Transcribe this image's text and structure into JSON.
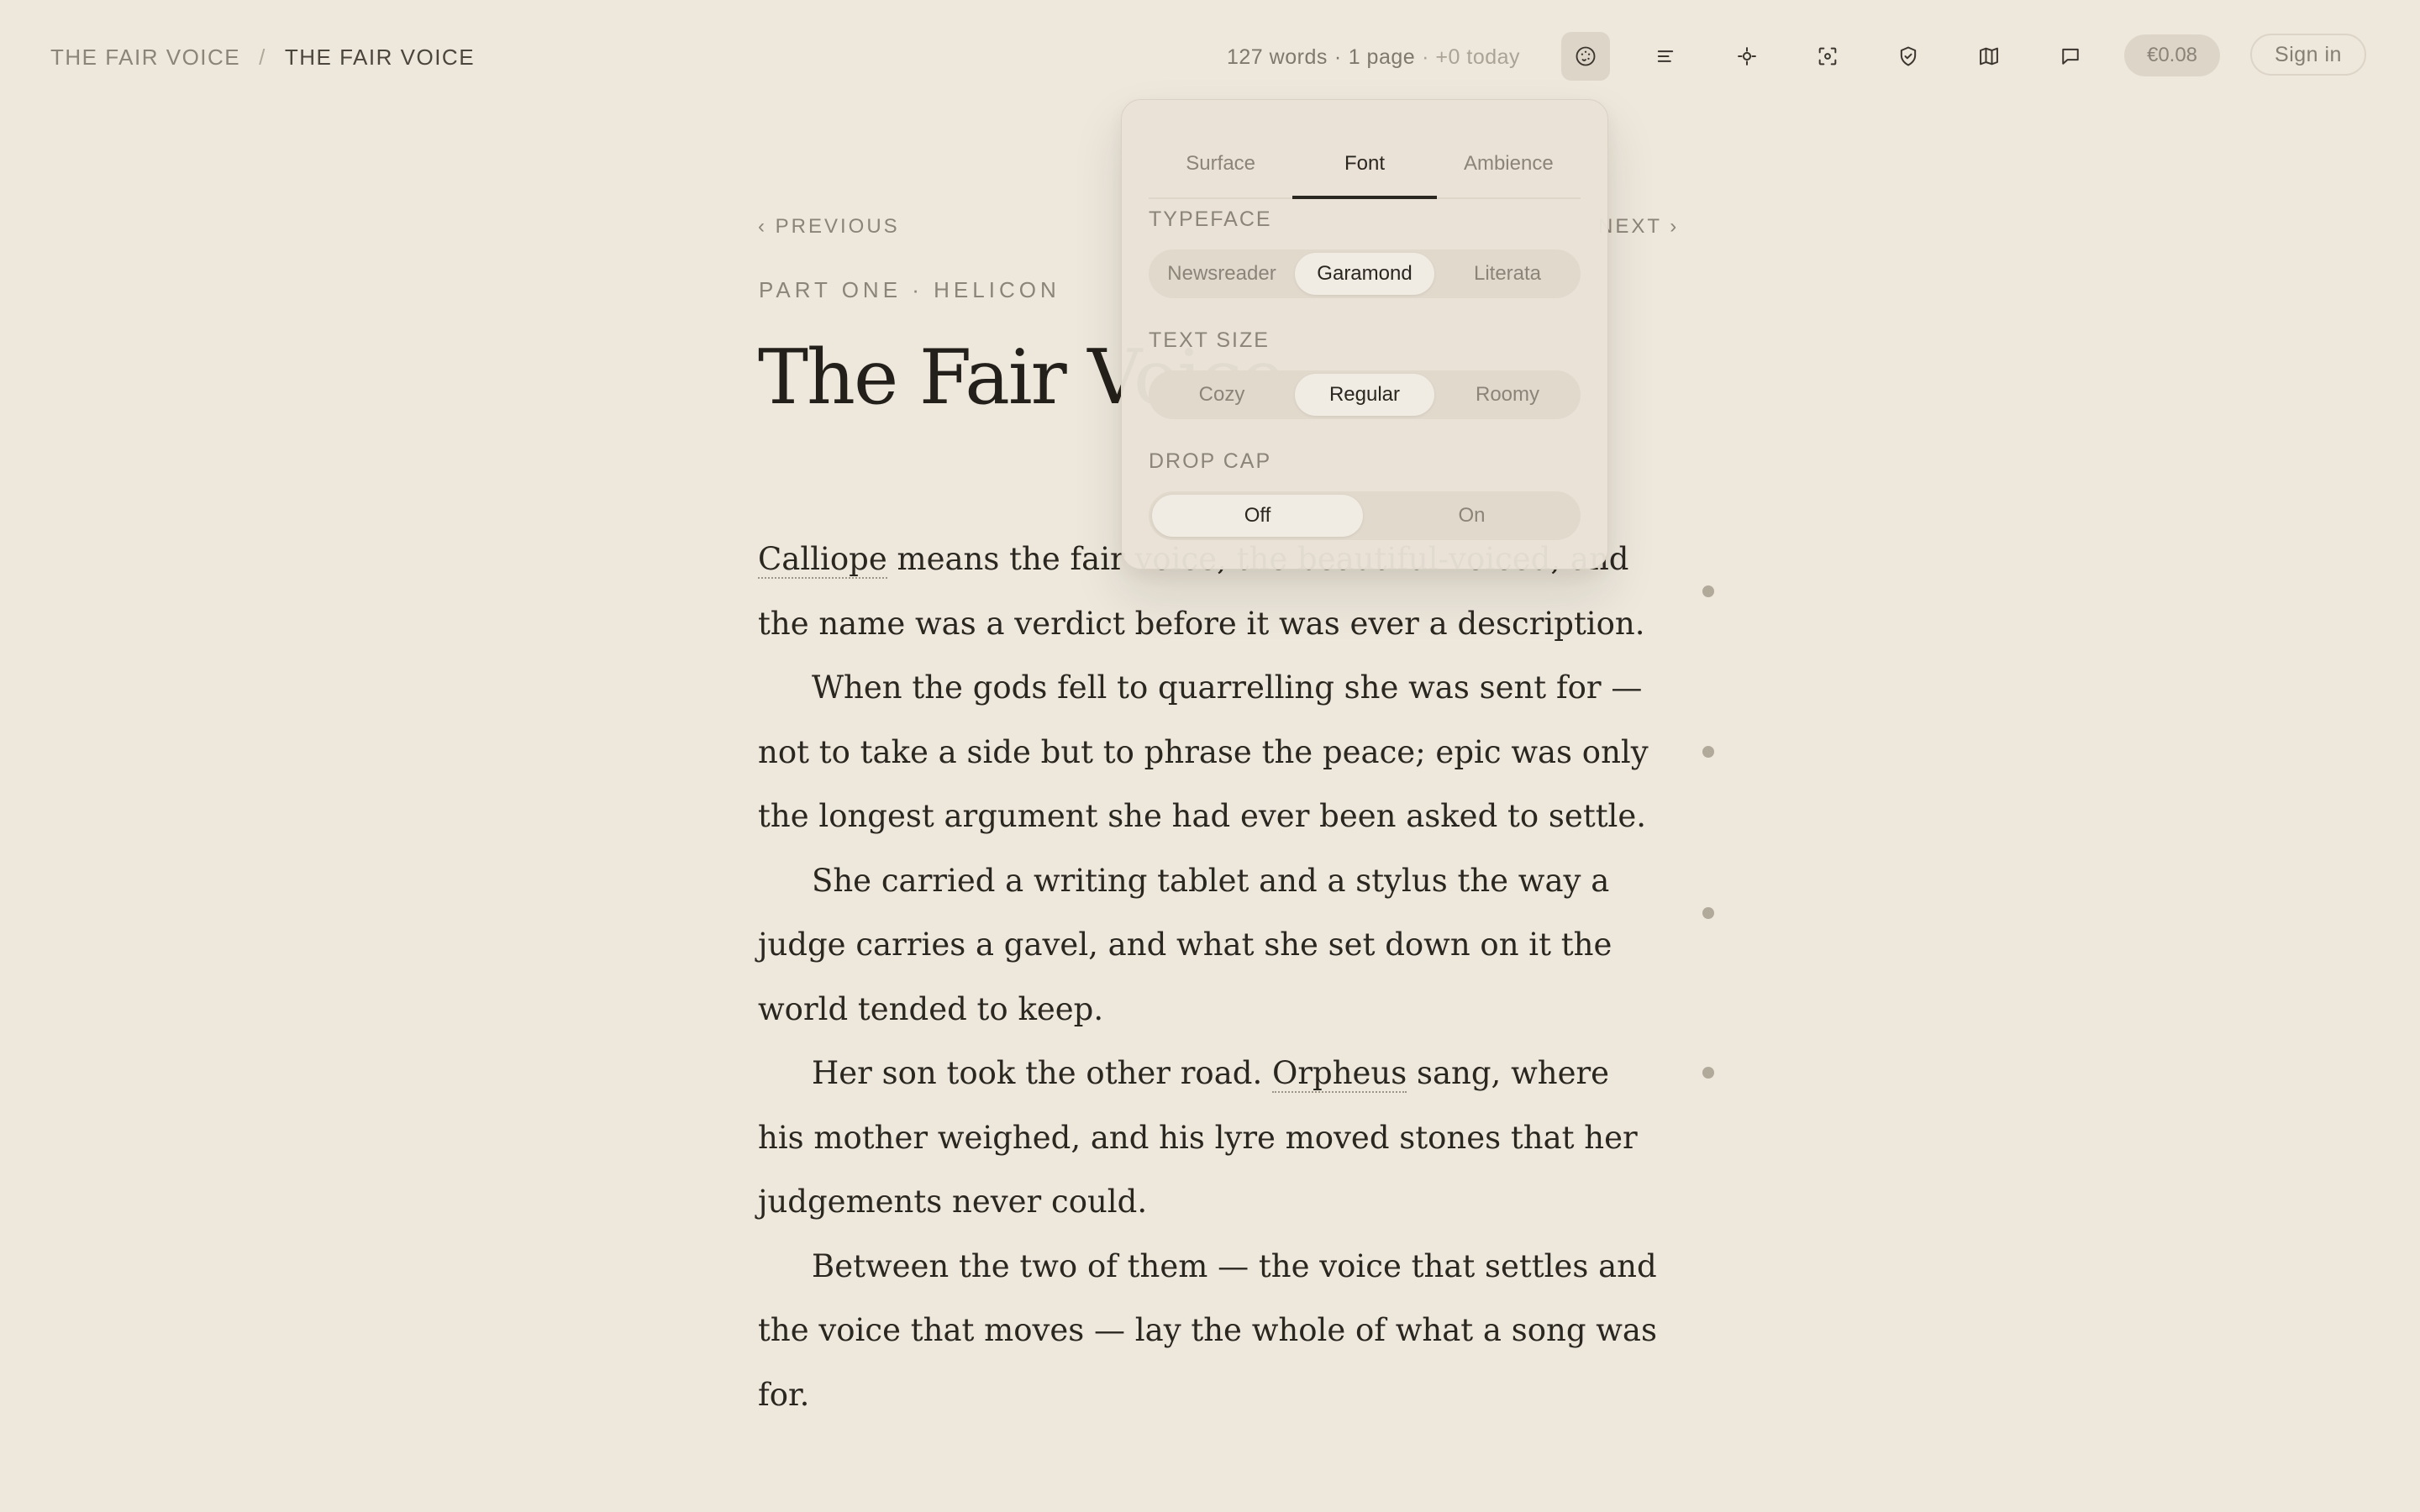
{
  "breadcrumb": {
    "root": "THE FAIR VOICE",
    "separator": "/",
    "current": "THE FAIR VOICE"
  },
  "stats": {
    "words": "127 words",
    "dot": "·",
    "pages": "1 page",
    "today": "· +0 today"
  },
  "toolbar": {
    "icons": [
      "palette-icon",
      "align-icon",
      "focus-icon",
      "capture-icon",
      "shield-check-icon",
      "map-icon",
      "comment-icon"
    ],
    "active": "palette-icon",
    "price": "€0.08",
    "sign_in": "Sign in"
  },
  "article": {
    "prev_label": "‹ PREVIOUS",
    "next_label": "NEXT ›",
    "part_label": "PART ONE · HELICON",
    "title": "The Fair Voice",
    "paragraphs": [
      {
        "link1": "Calliope",
        "text1": " means the fair voice, the beautiful-voiced, and the name was a verdict before it was ever a description."
      },
      {
        "text1": "When the gods fell to quarrelling she was sent for — not to take a side but to phrase the peace; epic was only the longest argument she had ever been asked to settle."
      },
      {
        "text1": "She carried a writing tablet and a stylus the way a judge carries a gavel, and what she set down on it the world tended to keep."
      },
      {
        "text1": "Her son took the other road. ",
        "link1": "Orpheus",
        "text2": " sang, where his mother weighed, and his lyre moved stones that her judgements never could."
      },
      {
        "text1": "Between the two of them — the voice that settles and the voice that moves — lay the whole of what a song was for."
      }
    ]
  },
  "font_panel": {
    "tabs": [
      "Surface",
      "Font",
      "Ambience"
    ],
    "selected_tab": "Font",
    "typeface": {
      "label": "TYPEFACE",
      "options": [
        "Newsreader",
        "Garamond",
        "Literata"
      ],
      "selected": "Garamond"
    },
    "text_size": {
      "label": "TEXT SIZE",
      "options": [
        "Cozy",
        "Regular",
        "Roomy"
      ],
      "selected": "Regular"
    },
    "drop_cap": {
      "label": "DROP CAP",
      "options": [
        "Off",
        "On"
      ],
      "selected": "Off"
    }
  },
  "colors": {
    "background": "#ede7dc",
    "text": "#2a2620",
    "muted": "#8b8478",
    "active_button": "#ddd5c8"
  }
}
